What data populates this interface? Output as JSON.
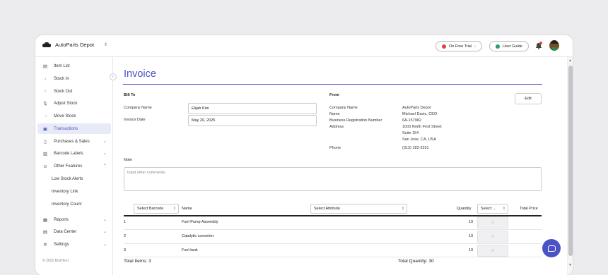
{
  "header": {
    "app_name": "AutoParts Depot",
    "trial_label": "On Free Trial",
    "guide_label": "User Guide",
    "trial_dot_color": "#e0413a",
    "guide_dot_color": "#2f9a6a"
  },
  "sidebar": {
    "items": [
      {
        "label": "Item List",
        "icon": "list-icon"
      },
      {
        "label": "Stock In",
        "icon": "stock-in-icon"
      },
      {
        "label": "Stock Out",
        "icon": "stock-out-icon"
      },
      {
        "label": "Adjust Stock",
        "icon": "adjust-icon"
      },
      {
        "label": "Move Stock",
        "icon": "move-icon"
      },
      {
        "label": "Transactions",
        "icon": "transactions-icon"
      },
      {
        "label": "Purchases & Sales",
        "icon": "purchase-icon"
      },
      {
        "label": "Barcode Labels",
        "icon": "barcode-icon"
      },
      {
        "label": "Other Features",
        "icon": "features-icon"
      },
      {
        "label": "Low Stock Alerts"
      },
      {
        "label": "Inventory Link"
      },
      {
        "label": "Inventory Count"
      },
      {
        "label": "Reports",
        "icon": "reports-icon"
      },
      {
        "label": "Data Center",
        "icon": "data-center-icon"
      },
      {
        "label": "Settings",
        "icon": "settings-icon"
      }
    ],
    "copyright": "© 2025 BoxHero"
  },
  "invoice": {
    "title": "Invoice",
    "bill_to_label": "Bill To",
    "company_name_label": "Company Name",
    "company_name_value": "Elijah Kim",
    "invoice_date_label": "Invoice Date",
    "invoice_date_value": "May 20, 2025",
    "from_label": "From",
    "edit_label": "Edit",
    "from": {
      "company_label": "Company Name",
      "company_value": "AutoParts Depot",
      "name_label": "Name",
      "name_value": "Michael Davis, CEO",
      "brn_label": "Business Registration Number",
      "brn_value": "6A-157982",
      "address_label": "Address",
      "address_line1": "1003 North First Street",
      "address_line2": "Suite 154",
      "address_line3": "San Jose, CA, USA",
      "phone_label": "Phone",
      "phone_value": "(313) 182-2351"
    },
    "note_label": "Note",
    "note_placeholder": "Input other comments.",
    "table": {
      "barcode_select": "Select Barcode",
      "name_header": "Name",
      "attribute_select": "Select Attribute",
      "quantity_header": "Quantity",
      "qty_select": "Select ...",
      "total_price_header": "Total Price",
      "rows": [
        {
          "no": "1",
          "name": "Fuel Pump Assembly",
          "qty": "10",
          "price": "0"
        },
        {
          "no": "2",
          "name": "Catalytic converter",
          "qty": "10",
          "price": "0"
        },
        {
          "no": "3",
          "name": "Fuel tank",
          "qty": "10",
          "price": "0"
        }
      ],
      "total_items": "Total Items: 3",
      "total_quantity": "Total Quantity: 30"
    }
  },
  "colors": {
    "accent": "#4b52c4",
    "active_bg": "#e8eaf8"
  }
}
